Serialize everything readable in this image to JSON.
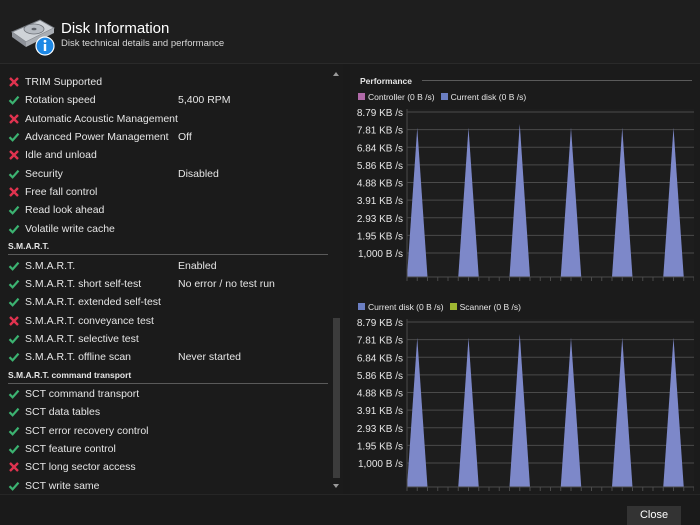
{
  "header": {
    "title": "Disk Information",
    "subtitle": "Disk technical details and performance",
    "icon": "disk-info-icon"
  },
  "colors": {
    "check": "#3cb371",
    "cross": "#e0334f",
    "controller": "#b06aa8",
    "current_disk": "#6b7ec2",
    "scanner": "#9fb832",
    "area_fill": "#7d88c9",
    "grid": "#4a4a4a"
  },
  "features": [
    {
      "status": "cross",
      "label": "TRIM Supported",
      "value": ""
    },
    {
      "status": "check",
      "label": "Rotation speed",
      "value": "5,400 RPM"
    },
    {
      "status": "cross",
      "label": "Automatic Acoustic Management",
      "value": ""
    },
    {
      "status": "check",
      "label": "Advanced Power Management",
      "value": "Off"
    },
    {
      "status": "cross",
      "label": "Idle and unload",
      "value": ""
    },
    {
      "status": "check",
      "label": "Security",
      "value": "Disabled"
    },
    {
      "status": "cross",
      "label": "Free fall control",
      "value": ""
    },
    {
      "status": "check",
      "label": "Read look ahead",
      "value": ""
    },
    {
      "status": "check",
      "label": "Volatile write cache",
      "value": ""
    }
  ],
  "smart": {
    "title": "S.M.A.R.T.",
    "items": [
      {
        "status": "check",
        "label": "S.M.A.R.T.",
        "value": "Enabled"
      },
      {
        "status": "check",
        "label": "S.M.A.R.T. short self-test",
        "value": "No error / no test run"
      },
      {
        "status": "check",
        "label": "S.M.A.R.T. extended self-test",
        "value": ""
      },
      {
        "status": "cross",
        "label": "S.M.A.R.T. conveyance test",
        "value": ""
      },
      {
        "status": "check",
        "label": "S.M.A.R.T. selective test",
        "value": ""
      },
      {
        "status": "check",
        "label": "S.M.A.R.T. offline scan",
        "value": "Never started"
      }
    ]
  },
  "sct": {
    "title": "S.M.A.R.T. command transport",
    "items": [
      {
        "status": "check",
        "label": "SCT command transport",
        "value": ""
      },
      {
        "status": "check",
        "label": "SCT data tables",
        "value": ""
      },
      {
        "status": "check",
        "label": "SCT error recovery control",
        "value": ""
      },
      {
        "status": "check",
        "label": "SCT feature control",
        "value": ""
      },
      {
        "status": "cross",
        "label": "SCT long sector access",
        "value": ""
      },
      {
        "status": "check",
        "label": "SCT write same",
        "value": ""
      }
    ]
  },
  "performance": {
    "title": "Performance"
  },
  "chart_data": [
    {
      "type": "area",
      "legend": [
        {
          "name": "Controller (0 B /s)",
          "color": "#b06aa8"
        },
        {
          "name": "Current disk (0 B /s)",
          "color": "#6b7ec2"
        }
      ],
      "y_ticks": [
        "8.79 KB /s",
        "7.81 KB /s",
        "6.84 KB /s",
        "5.86 KB /s",
        "4.88 KB /s",
        "3.91 KB /s",
        "2.93 KB /s",
        "1.95 KB /s",
        "1,000 B /s"
      ],
      "ylim": [
        0,
        9000
      ],
      "grid": true,
      "series": [
        {
          "name": "Current disk",
          "values": [
            0,
            8000,
            0,
            0,
            0,
            0,
            8000,
            0,
            0,
            0,
            0,
            8200,
            0,
            0,
            0,
            0,
            8000,
            0,
            0,
            0,
            0,
            8000,
            0,
            0,
            0,
            0,
            8000,
            0,
            0
          ]
        }
      ]
    },
    {
      "type": "area",
      "legend": [
        {
          "name": "Current disk (0 B /s)",
          "color": "#6b7ec2"
        },
        {
          "name": "Scanner (0 B /s)",
          "color": "#9fb832"
        }
      ],
      "y_ticks": [
        "8.79 KB /s",
        "7.81 KB /s",
        "6.84 KB /s",
        "5.86 KB /s",
        "4.88 KB /s",
        "3.91 KB /s",
        "2.93 KB /s",
        "1.95 KB /s",
        "1,000 B /s"
      ],
      "ylim": [
        0,
        9000
      ],
      "grid": true,
      "series": [
        {
          "name": "Current disk",
          "values": [
            0,
            8000,
            0,
            0,
            0,
            0,
            8000,
            0,
            0,
            0,
            0,
            8200,
            0,
            0,
            0,
            0,
            8000,
            0,
            0,
            0,
            0,
            8000,
            0,
            0,
            0,
            0,
            8000,
            0,
            0
          ]
        }
      ]
    }
  ],
  "footer": {
    "close_label": "Close"
  }
}
